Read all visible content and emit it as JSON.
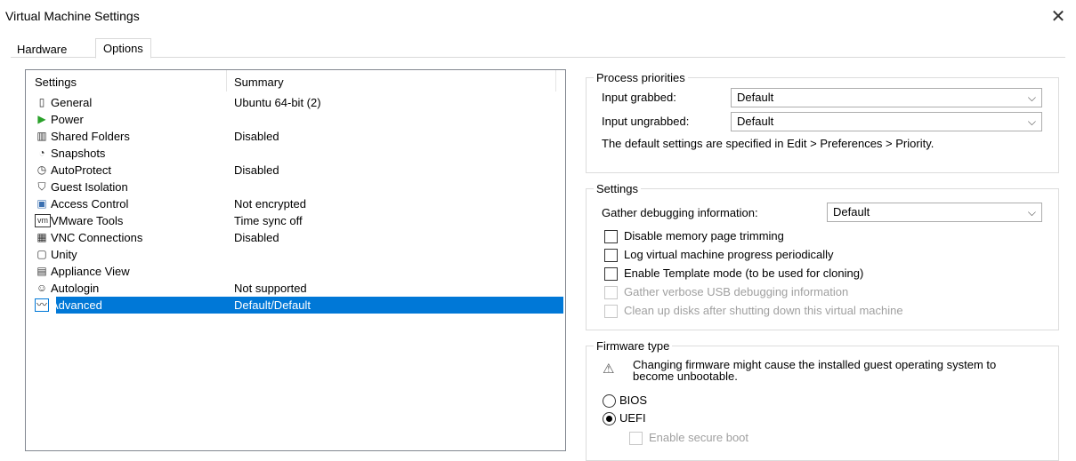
{
  "window": {
    "title": "Virtual Machine Settings",
    "close_glyph": "✕"
  },
  "tabs": [
    {
      "label": "Hardware",
      "active": false
    },
    {
      "label": "Options",
      "active": true
    }
  ],
  "settings_list": {
    "col_settings": "Settings",
    "col_summary": "Summary",
    "items": [
      {
        "icon": "monitor-icon",
        "glyph": "▯",
        "name": "General",
        "summary": "Ubuntu 64-bit (2)"
      },
      {
        "icon": "play-icon",
        "glyph": "▶",
        "name": "Power",
        "summary": ""
      },
      {
        "icon": "folder-icon",
        "glyph": "▥",
        "name": "Shared Folders",
        "summary": "Disabled"
      },
      {
        "icon": "snapshot-icon",
        "glyph": "◔",
        "name": "Snapshots",
        "summary": ""
      },
      {
        "icon": "clock-icon",
        "glyph": "◷",
        "name": "AutoProtect",
        "summary": "Disabled"
      },
      {
        "icon": "lock-icon",
        "glyph": "⛉",
        "name": "Guest Isolation",
        "summary": ""
      },
      {
        "icon": "access-control-icon",
        "glyph": "▣",
        "name": "Access Control",
        "summary": "Not encrypted"
      },
      {
        "icon": "vmware-tools-icon",
        "glyph": "vm",
        "name": "VMware Tools",
        "summary": "Time sync off"
      },
      {
        "icon": "vnc-icon",
        "glyph": "▦",
        "name": "VNC Connections",
        "summary": "Disabled"
      },
      {
        "icon": "unity-icon",
        "glyph": "▢",
        "name": "Unity",
        "summary": ""
      },
      {
        "icon": "appliance-icon",
        "glyph": "▤",
        "name": "Appliance View",
        "summary": ""
      },
      {
        "icon": "users-icon",
        "glyph": "☺",
        "name": "Autologin",
        "summary": "Not supported"
      },
      {
        "icon": "waveform-icon",
        "glyph": "〰",
        "name": "Advanced",
        "summary": "Default/Default",
        "selected": true
      }
    ]
  },
  "process_priorities": {
    "title": "Process priorities",
    "input_grabbed_label": "Input grabbed:",
    "input_grabbed_value": "Default",
    "input_ungrabbed_label": "Input ungrabbed:",
    "input_ungrabbed_value": "Default",
    "note": "The default settings are specified in Edit > Preferences > Priority."
  },
  "settings_group": {
    "title": "Settings",
    "debug_label": "Gather debugging information:",
    "debug_value": "Default",
    "checkboxes": [
      {
        "label": "Disable memory page trimming",
        "checked": false,
        "disabled": false
      },
      {
        "label": "Log virtual machine progress periodically",
        "checked": false,
        "disabled": false
      },
      {
        "label": "Enable Template mode (to be used for cloning)",
        "checked": false,
        "disabled": false
      },
      {
        "label": "Gather verbose USB debugging information",
        "checked": false,
        "disabled": true
      },
      {
        "label": "Clean up disks after shutting down this virtual machine",
        "checked": false,
        "disabled": true
      }
    ]
  },
  "firmware": {
    "title": "Firmware type",
    "warning": "Changing firmware might cause the installed guest operating system to become unbootable.",
    "options": [
      {
        "label": "BIOS",
        "checked": false
      },
      {
        "label": "UEFI",
        "checked": true
      }
    ],
    "secure_boot_label": "Enable secure boot"
  }
}
